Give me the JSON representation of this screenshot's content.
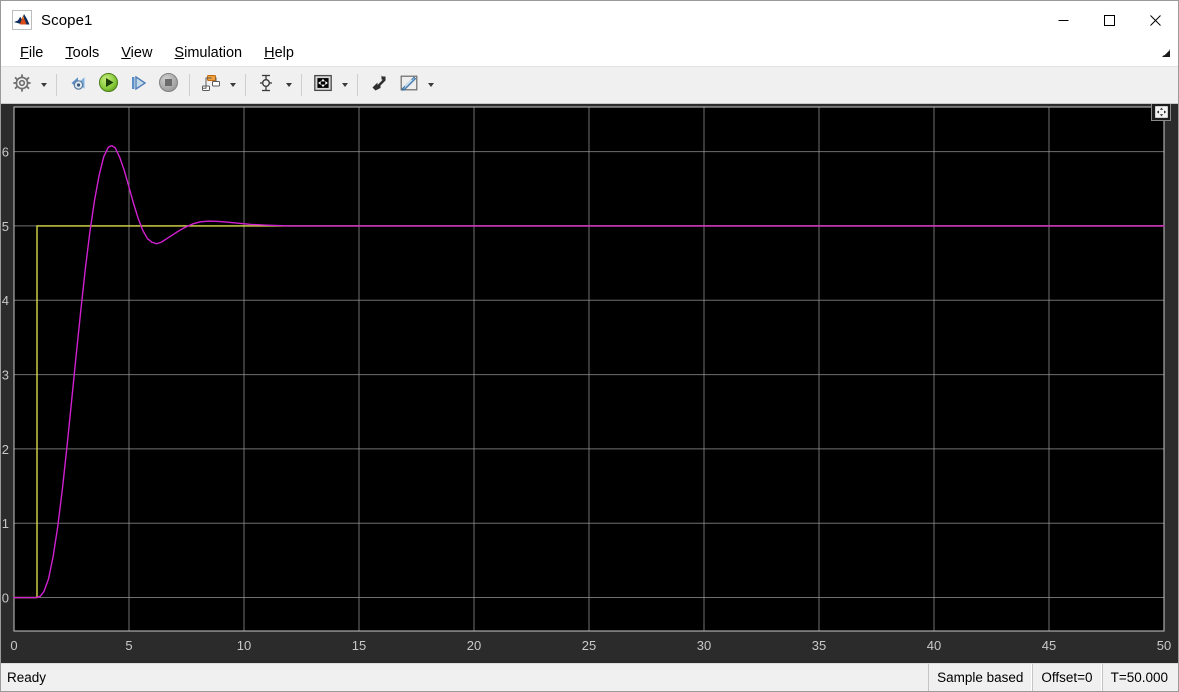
{
  "window": {
    "title": "Scope1",
    "app_icon": "matlab-icon",
    "controls": {
      "minimize": "minimize-icon",
      "maximize": "maximize-icon",
      "close": "close-icon"
    }
  },
  "menubar": {
    "items": [
      {
        "label": "File",
        "mnemonic": "F",
        "rest": "ile"
      },
      {
        "label": "Tools",
        "mnemonic": "T",
        "rest": "ools"
      },
      {
        "label": "View",
        "mnemonic": "V",
        "rest": "iew"
      },
      {
        "label": "Simulation",
        "mnemonic": "S",
        "rest": "imulation"
      },
      {
        "label": "Help",
        "mnemonic": "H",
        "rest": "elp"
      }
    ],
    "dock_control": "undock-arrow-icon"
  },
  "toolbar": {
    "buttons": [
      {
        "name": "configuration-properties",
        "icon": "gear-icon",
        "has_caret": true
      },
      {
        "name": "run-back-to-start",
        "icon": "rewind-icon",
        "has_caret": false
      },
      {
        "name": "run",
        "icon": "play-icon",
        "has_caret": false
      },
      {
        "name": "step-forward",
        "icon": "step-forward-icon",
        "has_caret": false
      },
      {
        "name": "stop",
        "icon": "stop-icon",
        "has_caret": false
      },
      {
        "name": "simulink-model",
        "icon": "model-blocks-icon",
        "has_caret": true
      },
      {
        "name": "cursor-measurements",
        "icon": "cursor-measure-icon",
        "has_caret": true
      },
      {
        "name": "autoscale",
        "icon": "autoscale-icon",
        "has_caret": true
      },
      {
        "name": "zoom-in-y",
        "icon": "zoom-y-icon",
        "has_caret": false
      },
      {
        "name": "style",
        "icon": "style-pencil-icon",
        "has_caret": true
      }
    ]
  },
  "plot": {
    "maximize_axes_icon": "maximize-axes-icon",
    "background": "#000000",
    "grid_color": "#9a9a9a",
    "outer_background": "#2b2b2b",
    "tick_label_color": "#c8c8c8"
  },
  "statusbar": {
    "ready": "Ready",
    "sample_mode": "Sample based",
    "offset": "Offset=0",
    "time": "T=50.000"
  },
  "chart_data": {
    "type": "line",
    "title": "",
    "xlabel": "",
    "ylabel": "",
    "xlim": [
      0,
      50
    ],
    "ylim": [
      -0.45,
      6.6
    ],
    "xticks": [
      0,
      5,
      10,
      15,
      20,
      25,
      30,
      35,
      40,
      45,
      50
    ],
    "yticks": [
      0,
      1,
      2,
      3,
      4,
      5,
      6
    ],
    "grid": true,
    "legend": null,
    "series": [
      {
        "name": "reference-step",
        "color": "#d8d84a",
        "points": [
          [
            0,
            0
          ],
          [
            1,
            0
          ],
          [
            1,
            5
          ],
          [
            50,
            5
          ]
        ]
      },
      {
        "name": "system-response",
        "color": "#d020d0",
        "points": [
          [
            0,
            0
          ],
          [
            1.0,
            0
          ],
          [
            1.15,
            0.02
          ],
          [
            1.3,
            0.08
          ],
          [
            1.5,
            0.25
          ],
          [
            1.7,
            0.55
          ],
          [
            1.9,
            0.95
          ],
          [
            2.1,
            1.45
          ],
          [
            2.3,
            2.02
          ],
          [
            2.5,
            2.63
          ],
          [
            2.7,
            3.25
          ],
          [
            2.9,
            3.85
          ],
          [
            3.1,
            4.42
          ],
          [
            3.3,
            4.92
          ],
          [
            3.5,
            5.34
          ],
          [
            3.7,
            5.68
          ],
          [
            3.9,
            5.93
          ],
          [
            4.1,
            6.06
          ],
          [
            4.25,
            6.08
          ],
          [
            4.4,
            6.05
          ],
          [
            4.6,
            5.92
          ],
          [
            4.8,
            5.74
          ],
          [
            5.0,
            5.52
          ],
          [
            5.2,
            5.3
          ],
          [
            5.4,
            5.1
          ],
          [
            5.6,
            4.94
          ],
          [
            5.8,
            4.83
          ],
          [
            6.0,
            4.78
          ],
          [
            6.2,
            4.76
          ],
          [
            6.4,
            4.78
          ],
          [
            6.6,
            4.82
          ],
          [
            6.9,
            4.88
          ],
          [
            7.2,
            4.94
          ],
          [
            7.5,
            4.99
          ],
          [
            7.8,
            5.03
          ],
          [
            8.1,
            5.055
          ],
          [
            8.5,
            5.065
          ],
          [
            8.9,
            5.06
          ],
          [
            9.3,
            5.05
          ],
          [
            9.8,
            5.035
          ],
          [
            10.3,
            5.02
          ],
          [
            11.0,
            5.01
          ],
          [
            12.0,
            5.0
          ],
          [
            14.0,
            5.0
          ],
          [
            20.0,
            5.0
          ],
          [
            30.0,
            5.0
          ],
          [
            40.0,
            5.0
          ],
          [
            50.0,
            5.0
          ]
        ]
      }
    ]
  }
}
